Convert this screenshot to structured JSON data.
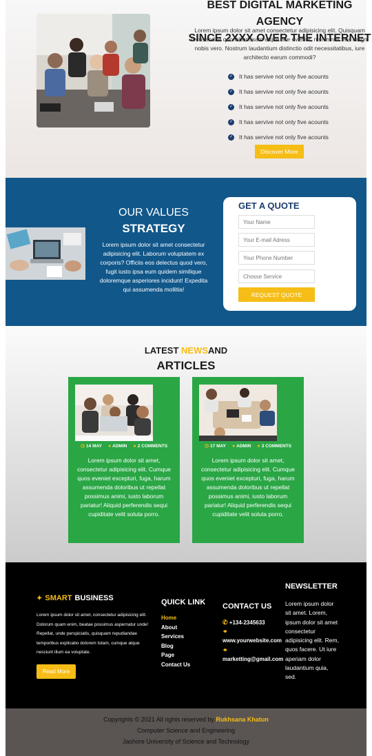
{
  "hero": {
    "title_line1": "BEST DIGITAL MARKETING AGENCY",
    "title_line2": "SINCE 2XXX OVER THE INTERNET",
    "description": "Lorem ipsum dolor sit amet consectetur adipisicing elit. Quisquam recusandae quo laboriosam atque iste eveniet, nisi minus eos magni nobis vero. Nostrum laudantium distinctio odit necessitatibus, iure architecto earum commodi?",
    "checklist": [
      "It has servive not only five acounts",
      "It has servive not only five acounts",
      "It has servive not only five acounts",
      "It has servive not only five acounts",
      "It has servive not only five acounts"
    ],
    "button_label": "Discover More"
  },
  "values": {
    "title_line1": "OUR VALUES",
    "title_line2": "STRATEGY",
    "description": "Lorem ipsum dolor sit amet consectetur adipisicing elit. Laborum voluptatem ex corporis? Officiis eos delectus quod vero, fugit iusto ipsa eum quidem similique doloremque asperiores incidunt! Expedita qui assumenda mollitia!"
  },
  "quote": {
    "title": "GET A QUOTE",
    "name_placeholder": "Your Name",
    "email_placeholder": "Your E-mail Adress",
    "phone_placeholder": "Your Phone Number",
    "service_placeholder": "Chosse Service",
    "button_label": "REQUEST QUOTE"
  },
  "news": {
    "heading_prefix": "LATEST ",
    "heading_accent": "NEWS",
    "heading_suffix": "AND",
    "heading_line2": "ARTICLES",
    "cards": [
      {
        "date": "14 MAY",
        "author": "ADMIN",
        "comments": "2 COMMENTS",
        "text": "Lorem ipsum dolor sit amet, consectetur adipisicing elit. Cumque quos eveniet excepturi, fuga, harum assumenda doloribus ut repellat possimus animi, iusto laborum pariatur! Aliquid perferendis sequi cupiditate velit soluta porro."
      },
      {
        "date": "17 MAY",
        "author": "ADMIN",
        "comments": "3 COMMENTS",
        "text": "Lorem ipsum dolor sit amet, consectetur adipisicing elit. Cumque quos eveniet excepturi, fuga, harum assumenda doloribus ut repellat possimus animi, iusto laborum pariatur! Aliquid perferendis sequi cupiditate velit soluta porro."
      }
    ]
  },
  "footer": {
    "brand_accent": "SMART",
    "brand_rest": "BUSINESS",
    "about": "Lorem ipsum dolor sit amet, consectetur adipisicing elit. Dolorum quam enim, beatae possimus aspernatur unde! Repellat, unde perspiciatis, quisquam repudiandae temporibus explicabo dolorem totam, cumque atque nesciunt illum ea voluptate.",
    "readmore_label": "Read More",
    "quick_link_title": "QUICK LINK",
    "quick_links": [
      "Home",
      "About",
      "Services",
      "Blog",
      "Page",
      "Contact Us"
    ],
    "contact_title": "CONTACT US",
    "phone": "+134-2345633",
    "website": "www.yourwebsite.com",
    "email": "marketting@gmail.com",
    "newsletter_title": "NEWSLETTER",
    "newsletter_text": "Lorem ipsum dolor sit amet. Lorem, ipsum dolor sit amet consectetur adipisicing elit. Rem, quos facere. Ut iure aperiam dolor laudantium quia, sed."
  },
  "copyright": {
    "prefix": "Copyrights © 2021 All rights reserved by",
    "author": "Rukhsana Khatun",
    "line2": "Computer Science and Engineering",
    "line3": "Jashore University of Science and Technology"
  },
  "colors": {
    "accent": "#f5bd16",
    "navy": "#11578a",
    "green": "#2aa645",
    "footer": "#000000",
    "copyright_bg": "#5a5553"
  },
  "icons": {
    "check": "check-circle-icon",
    "clock": "clock-icon",
    "user": "user-icon",
    "phone": "phone-icon",
    "link": "link-icon",
    "handshake": "handshake-icon"
  }
}
